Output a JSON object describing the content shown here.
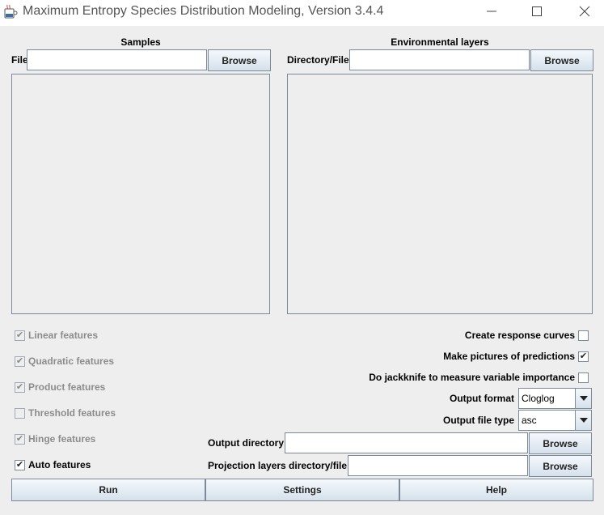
{
  "window": {
    "title": "Maximum Entropy Species Distribution Modeling, Version 3.4.4",
    "app_icon": "java-cup-icon",
    "controls": {
      "minimize": "minimize-icon",
      "maximize": "maximize-icon",
      "close": "close-icon"
    }
  },
  "samples": {
    "heading": "Samples",
    "file_label": "File",
    "file_value": "",
    "browse_label": "Browse"
  },
  "environmental": {
    "heading": "Environmental layers",
    "dir_label": "Directory/File",
    "dir_value": "",
    "browse_label": "Browse"
  },
  "features": [
    {
      "label": "Linear features",
      "checked": true,
      "enabled": false
    },
    {
      "label": "Quadratic features",
      "checked": true,
      "enabled": false
    },
    {
      "label": "Product features",
      "checked": true,
      "enabled": false
    },
    {
      "label": "Threshold features",
      "checked": false,
      "enabled": false
    },
    {
      "label": "Hinge features",
      "checked": true,
      "enabled": false
    },
    {
      "label": "Auto features",
      "checked": true,
      "enabled": true
    }
  ],
  "options": [
    {
      "label": "Create response curves",
      "checked": false
    },
    {
      "label": "Make pictures of predictions",
      "checked": true
    },
    {
      "label": "Do jackknife to measure variable importance",
      "checked": false
    }
  ],
  "output_format": {
    "label": "Output format",
    "value": "Cloglog"
  },
  "output_file_type": {
    "label": "Output file type",
    "value": "asc"
  },
  "output_directory": {
    "label": "Output directory",
    "value": "",
    "browse_label": "Browse"
  },
  "projection": {
    "label": "Projection layers directory/file",
    "value": "",
    "browse_label": "Browse"
  },
  "actions": {
    "run": "Run",
    "settings": "Settings",
    "help": "Help"
  },
  "colors": {
    "background": "#eeeeee",
    "border": "#7a8a99",
    "button_top": "#f4f8fc",
    "button_bottom": "#d6e1ec"
  }
}
